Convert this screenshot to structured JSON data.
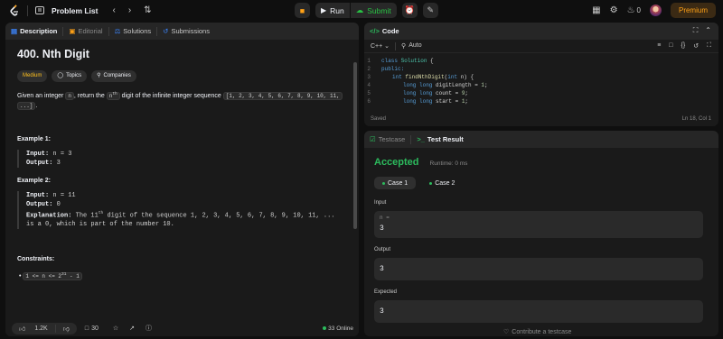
{
  "topbar": {
    "title": "Problem List",
    "run_label": "Run",
    "submit_label": "Submit",
    "fire_count": "0",
    "premium_label": "Premium"
  },
  "colors": {
    "accent": "#ffa116",
    "success": "#2cbb5d",
    "medium": "#ffc01e",
    "submit": "#28c244"
  },
  "description": {
    "tabs": [
      {
        "label": "Description"
      },
      {
        "label": "Editorial"
      },
      {
        "label": "Solutions"
      },
      {
        "label": "Submissions"
      }
    ],
    "title": "400. Nth Digit",
    "difficulty": "Medium",
    "topics_label": "Topics",
    "companies_label": "Companies",
    "para_a": "Given an integer ",
    "code_n": "n",
    "para_b": ", return the ",
    "code_nth": "n",
    "sup_th": "th",
    "para_c": " digit of the infinite integer sequence ",
    "code_seq": "[1, 2, 3, 4, 5, 6, 7, 8, 9, 10, 11,",
    "code_seq2": "...]",
    "para_d": ".",
    "ex1_title": "Example 1:",
    "ex1_input_label": "Input:",
    "ex1_input": "n = 3",
    "ex1_output_label": "Output:",
    "ex1_output": "3",
    "ex2_title": "Example 2:",
    "ex2_input_label": "Input:",
    "ex2_input": "n = 11",
    "ex2_output_label": "Output:",
    "ex2_output": "0",
    "ex2_expl_label": "Explanation:",
    "ex2_expl_a": "The 11",
    "ex2_expl_sup": "th",
    "ex2_expl_b": " digit of the sequence 1, 2, 3, 4, 5, 6, 7, 8, 9, 10, 11, ...",
    "ex2_expl_c": "is a 0, which is part of the number 10.",
    "constraints_title": "Constraints:",
    "constraint_a": "1 <= n <= 2",
    "constraint_sup": "31",
    "constraint_b": " - 1",
    "likes": "1.2K",
    "comments": "30",
    "online": "33 Online"
  },
  "code": {
    "header": "Code",
    "language": "C++",
    "mode": "Auto",
    "lines": [
      {
        "n": "1"
      },
      {
        "n": "2"
      },
      {
        "n": "3"
      },
      {
        "n": "4"
      },
      {
        "n": "5"
      },
      {
        "n": "6"
      }
    ],
    "l1_kw": "class",
    "l1_name": "Solution",
    "l1_rest": " {",
    "l2": "public:",
    "l3_ty": "int",
    "l3_fn": "findNthDigit",
    "l3_arg": "(",
    "l3_argt": "int",
    "l3_argn": " n) {",
    "l4_ty": "long long",
    "l4_rest": " digitLength = ",
    "l4_num": "1",
    "l4_end": ";",
    "l5_ty": "long long",
    "l5_rest": " count = ",
    "l5_num": "9",
    "l5_end": ";",
    "l6_ty": "long long",
    "l6_rest": " start = ",
    "l6_num": "1",
    "l6_end": ";",
    "status": "Saved",
    "cursor": "Ln 18, Col 1"
  },
  "results": {
    "tab_testcase": "Testcase",
    "tab_result": "Test Result",
    "status": "Accepted",
    "runtime": "Runtime: 0 ms",
    "case1": "Case 1",
    "case2": "Case 2",
    "input_label": "Input",
    "input_key": "n =",
    "input_value": "3",
    "output_label": "Output",
    "output_value": "3",
    "expected_label": "Expected",
    "expected_value": "3",
    "contribute": "Contribute a testcase"
  }
}
